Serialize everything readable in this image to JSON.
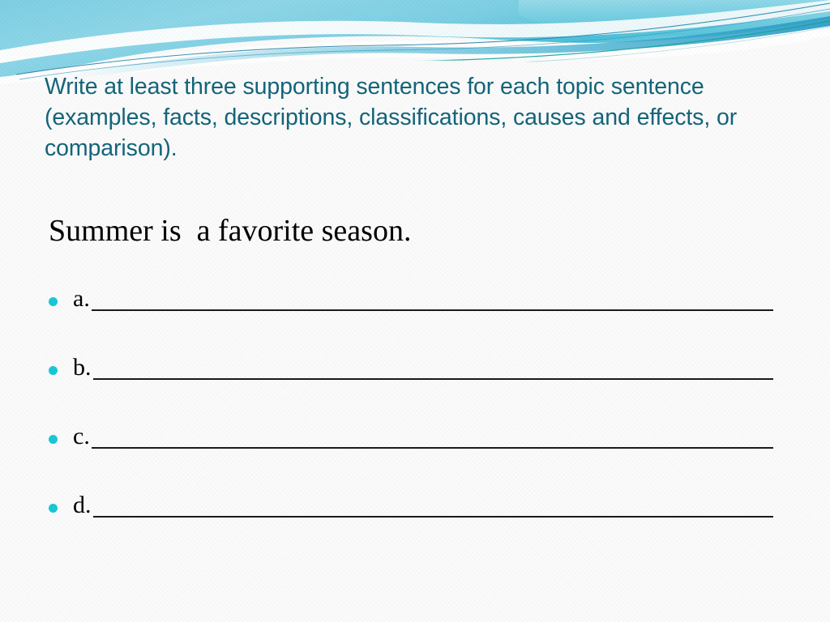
{
  "slide": {
    "background_color": "#fbfbfb",
    "banner": {
      "name": "wave-banner",
      "gradient_top_left": "#8fd4e8",
      "gradient_top_right": "#9fdde9",
      "gradient_mid": "#4fc4de",
      "accent_line_color": "#1f7fa8",
      "teal_line_color": "#11a19a",
      "white": "#ffffff"
    },
    "instructions": {
      "lines": [
        "Write at least three supporting sentences for each topic sentence",
        "(examples, facts, descriptions, classifications, causes and effects,",
        "or comparison)."
      ],
      "text": "Write at least three supporting sentences for each topic sentence (examples, facts, descriptions, classifications, causes and effects, or comparison).",
      "color": "#14657a"
    },
    "topic_sentence": {
      "text": "Summer is  a favorite season.",
      "color": "#000000"
    },
    "answers": {
      "bullet_color": "#17c8d6",
      "rule_color": "#1a1a1a",
      "items": [
        {
          "label": "a.",
          "value": ""
        },
        {
          "label": "b.",
          "value": ""
        },
        {
          "label": "c.",
          "value": ""
        },
        {
          "label": "d.",
          "value": ""
        }
      ]
    }
  }
}
